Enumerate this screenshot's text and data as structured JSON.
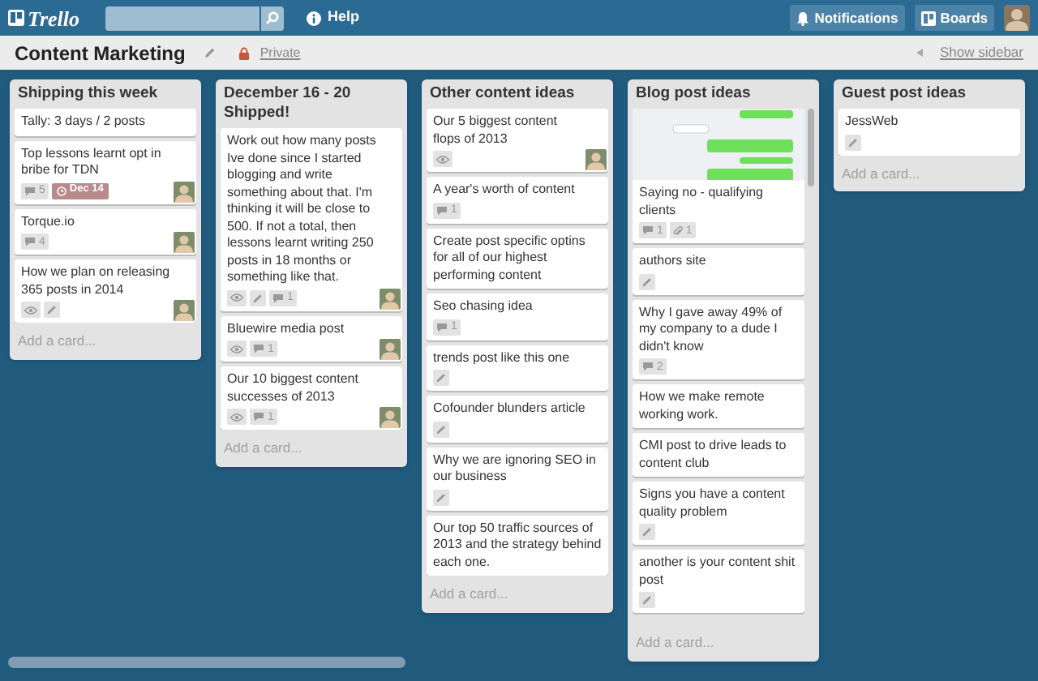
{
  "topbar": {
    "logo": "Trello",
    "help": "Help",
    "notifications": "Notifications",
    "boards": "Boards"
  },
  "board": {
    "title": "Content Marketing",
    "visibility": "Private",
    "sidebar_toggle": "Show sidebar"
  },
  "lists": [
    {
      "title": "Shipping this week",
      "scrolled": false,
      "add_card": "Add a card...",
      "cards": [
        {
          "text": "Tally: 3 days / 2 posts",
          "cover": false,
          "member": false
        },
        {
          "text": "Top lessons learnt opt in bribe for TDN",
          "cover": false,
          "member": true,
          "badges": [
            {
              "kind": "comments",
              "count": "5"
            },
            {
              "kind": "due",
              "count": "Dec 14"
            }
          ]
        },
        {
          "text": "Torque.io",
          "cover": false,
          "member": true,
          "badges": [
            {
              "kind": "comments",
              "count": "4"
            }
          ]
        },
        {
          "text": "How we plan on releasing 365 posts in 2014",
          "cover": false,
          "member": true,
          "badges": [
            {
              "kind": "watch"
            },
            {
              "kind": "description"
            }
          ]
        }
      ]
    },
    {
      "title": "December 16 - 20 Shipped!",
      "scrolled": false,
      "add_card": "Add a card...",
      "cards": [
        {
          "text": "Work out how many posts Ive done since I started blogging and write something about that. I'm thinking it will be close to 500. If not a total, then lessons learnt writing 250 posts in 18 months or something like that.",
          "cover": false,
          "member": true,
          "badges": [
            {
              "kind": "watch"
            },
            {
              "kind": "description"
            },
            {
              "kind": "comments",
              "count": "1"
            }
          ]
        },
        {
          "text": "Bluewire media post",
          "cover": false,
          "member": true,
          "badges": [
            {
              "kind": "watch"
            },
            {
              "kind": "comments",
              "count": "1"
            }
          ]
        },
        {
          "text": "Our 10 biggest content successes of 2013",
          "cover": false,
          "member": true,
          "badges": [
            {
              "kind": "watch"
            },
            {
              "kind": "comments",
              "count": "1"
            }
          ]
        }
      ]
    },
    {
      "title": "Other content ideas",
      "scrolled": false,
      "add_card": "Add a card...",
      "cards": [
        {
          "text": "Our 5 biggest content flops of 2013",
          "cover": false,
          "member": true,
          "badges": [
            {
              "kind": "watch"
            }
          ]
        },
        {
          "text": "A year's worth of content",
          "cover": false,
          "member": false,
          "badges": [
            {
              "kind": "comments",
              "count": "1"
            }
          ]
        },
        {
          "text": "Create post specific optins for all of our highest performing content",
          "cover": false,
          "member": false
        },
        {
          "text": "Seo chasing idea",
          "cover": false,
          "member": false,
          "badges": [
            {
              "kind": "comments",
              "count": "1"
            }
          ]
        },
        {
          "text": "trends post like this one",
          "cover": false,
          "member": false,
          "badges": [
            {
              "kind": "description"
            }
          ]
        },
        {
          "text": "Cofounder blunders article",
          "cover": false,
          "member": false,
          "badges": [
            {
              "kind": "description"
            }
          ]
        },
        {
          "text": "Why we are ignoring SEO in our business",
          "cover": false,
          "member": false,
          "badges": [
            {
              "kind": "description"
            }
          ]
        },
        {
          "text": "Our top 50 traffic sources of 2013 and the strategy behind each one.",
          "cover": false,
          "member": false
        }
      ]
    },
    {
      "title": "Blog post ideas",
      "scrolled": true,
      "add_card": "Add a card...",
      "cards": [
        {
          "text": "Saying no - qualifying clients",
          "cover": true,
          "member": false,
          "badges": [
            {
              "kind": "comments",
              "count": "1"
            },
            {
              "kind": "attachments",
              "count": "1"
            }
          ]
        },
        {
          "text": "authors site",
          "cover": false,
          "member": false,
          "badges": [
            {
              "kind": "description"
            }
          ]
        },
        {
          "text": "Why I gave away 49% of my company to a dude I didn't know",
          "cover": false,
          "member": false,
          "badges": [
            {
              "kind": "comments",
              "count": "2"
            }
          ]
        },
        {
          "text": "How we make remote working work.",
          "cover": false,
          "member": false
        },
        {
          "text": "CMI post to drive leads to content club",
          "cover": false,
          "member": false
        },
        {
          "text": "Signs you have a content quality problem",
          "cover": false,
          "member": false,
          "badges": [
            {
              "kind": "description"
            }
          ]
        },
        {
          "text": "another is your content shit post",
          "cover": false,
          "member": false,
          "badges": [
            {
              "kind": "description"
            }
          ]
        }
      ]
    },
    {
      "title": "Guest post ideas",
      "scrolled": false,
      "add_card": "Add a card...",
      "cards": [
        {
          "text": "JessWeb",
          "cover": false,
          "member": false,
          "badges": [
            {
              "kind": "description"
            }
          ]
        }
      ]
    }
  ]
}
